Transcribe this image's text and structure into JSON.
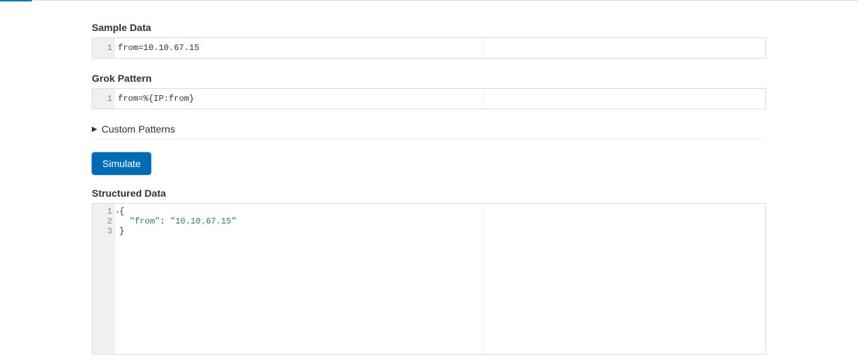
{
  "sampleData": {
    "label": "Sample Data",
    "lines": [
      "from=10.10.67.15"
    ]
  },
  "grokPattern": {
    "label": "Grok Pattern",
    "lines": [
      "from=%{IP:from}"
    ]
  },
  "customPatterns": {
    "label": "Custom Patterns"
  },
  "simulateButton": {
    "label": "Simulate"
  },
  "structuredData": {
    "label": "Structured Data",
    "json": {
      "from": "10.10.67.15"
    },
    "display": {
      "line1": "{",
      "line2_key": "\"from\"",
      "line2_colon": ": ",
      "line2_value": "\"10.10.67.15\"",
      "line3": "}"
    }
  }
}
